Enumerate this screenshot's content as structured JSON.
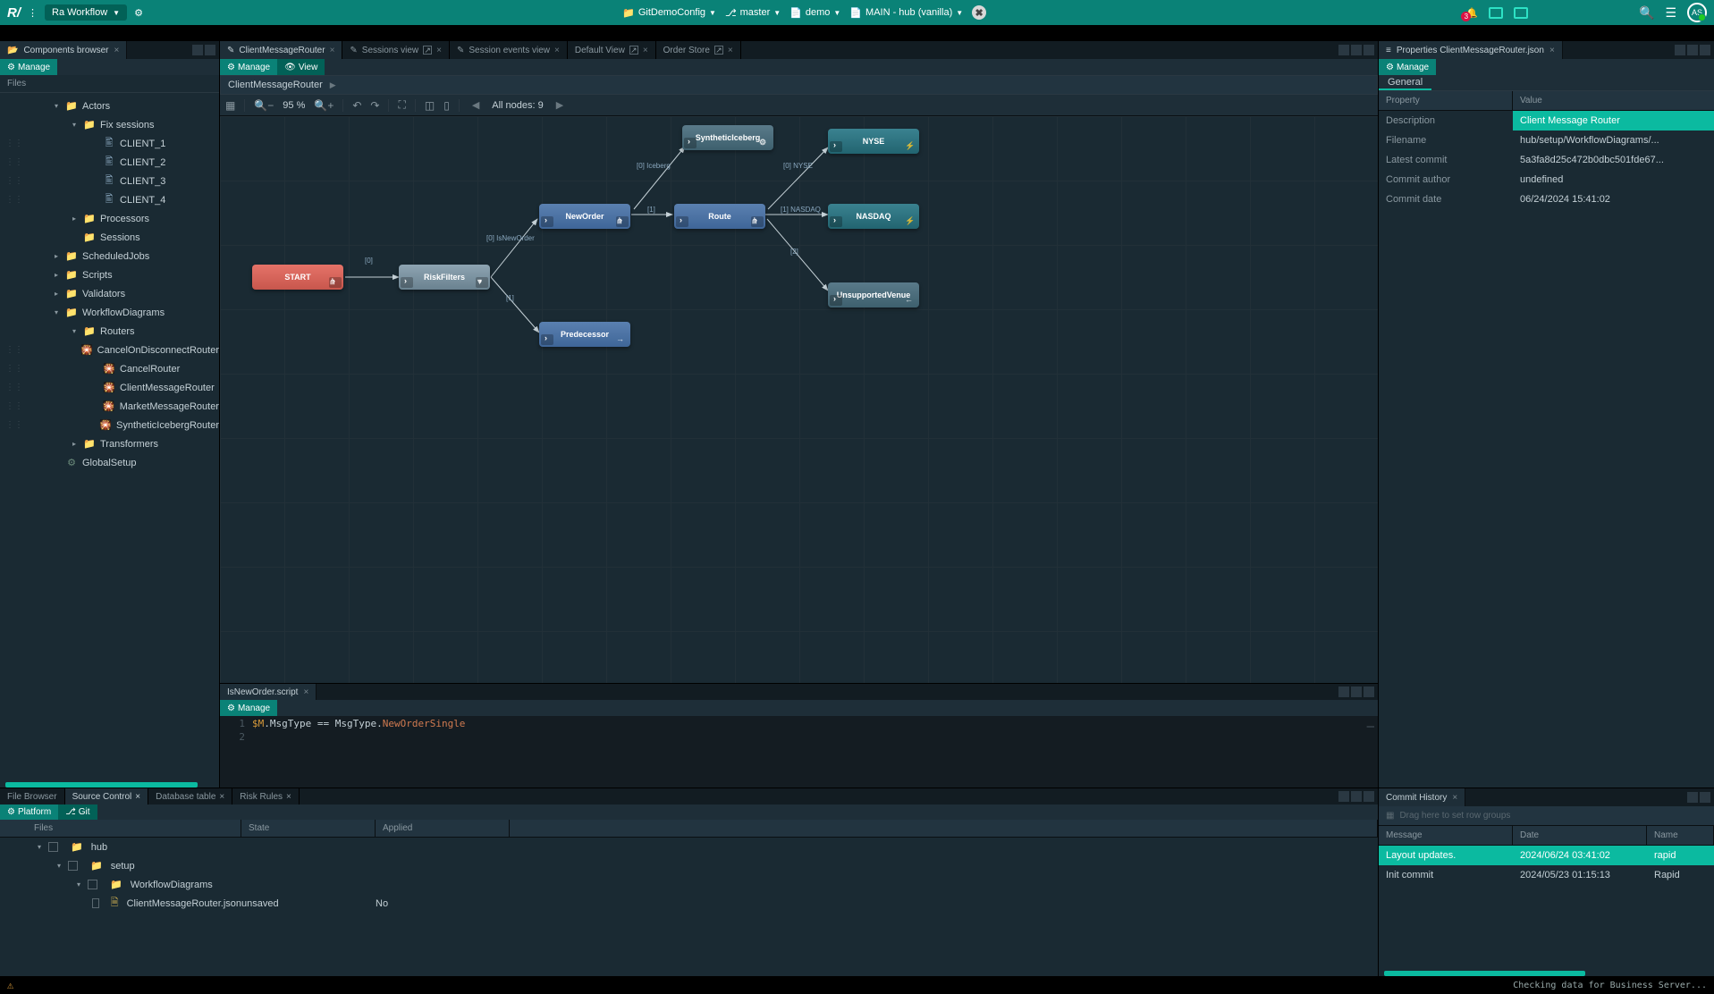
{
  "topbar": {
    "workflow": "Ra Workflow",
    "crumbs": [
      {
        "icon": "📁",
        "label": "GitDemoConfig"
      },
      {
        "icon": "🌿",
        "label": "master"
      },
      {
        "icon": "📄",
        "label": "demo"
      },
      {
        "icon": "📄",
        "label": "MAIN - hub (vanilla)"
      }
    ],
    "notif_count": "3",
    "avatar": "AS"
  },
  "left": {
    "tab": "Components browser",
    "manage": "Manage",
    "files_hdr": "Files",
    "tree": [
      {
        "ind": 30,
        "exp": "▾",
        "fic": "📁",
        "cls": "folder-ic",
        "label": "Actors"
      },
      {
        "ind": 50,
        "exp": "▾",
        "fic": "📁",
        "cls": "folder-purple",
        "label": "Fix sessions"
      },
      {
        "grip": "⋮⋮",
        "ind": 72,
        "fic": "🖺",
        "cls": "file-ic",
        "label": "CLIENT_1"
      },
      {
        "grip": "⋮⋮",
        "ind": 72,
        "fic": "🖺",
        "cls": "file-ic",
        "label": "CLIENT_2"
      },
      {
        "grip": "⋮⋮",
        "ind": 72,
        "fic": "🖺",
        "cls": "file-ic",
        "label": "CLIENT_3"
      },
      {
        "grip": "⋮⋮",
        "ind": 72,
        "fic": "🖺",
        "cls": "file-ic",
        "label": "CLIENT_4"
      },
      {
        "ind": 50,
        "exp": "▸",
        "fic": "📁",
        "cls": "folder-purple",
        "label": "Processors"
      },
      {
        "ind": 50,
        "exp": "",
        "fic": "📁",
        "cls": "folder-purple",
        "label": "Sessions"
      },
      {
        "ind": 30,
        "exp": "▸",
        "fic": "📁",
        "cls": "folder-ic",
        "label": "ScheduledJobs"
      },
      {
        "ind": 30,
        "exp": "▸",
        "fic": "📁",
        "cls": "folder-ic",
        "label": "Scripts"
      },
      {
        "ind": 30,
        "exp": "▸",
        "fic": "📁",
        "cls": "folder-ic",
        "label": "Validators"
      },
      {
        "ind": 30,
        "exp": "▾",
        "fic": "📁",
        "cls": "folder-ic",
        "label": "WorkflowDiagrams"
      },
      {
        "ind": 50,
        "exp": "▾",
        "fic": "📁",
        "cls": "folder-purple",
        "label": "Routers"
      },
      {
        "grip": "⋮⋮",
        "ind": 72,
        "fic": "🎇",
        "cls": "file-ic",
        "label": "CancelOnDisconnectRouter"
      },
      {
        "grip": "⋮⋮",
        "ind": 72,
        "fic": "🎇",
        "cls": "file-ic",
        "label": "CancelRouter"
      },
      {
        "grip": "⋮⋮",
        "ind": 72,
        "fic": "🎇",
        "cls": "file-ic",
        "label": "ClientMessageRouter"
      },
      {
        "grip": "⋮⋮",
        "ind": 72,
        "fic": "🎇",
        "cls": "file-ic",
        "label": "MarketMessageRouter"
      },
      {
        "grip": "⋮⋮",
        "ind": 72,
        "fic": "🎇",
        "cls": "file-ic",
        "label": "SyntheticIcebergRouter"
      },
      {
        "ind": 50,
        "exp": "▸",
        "fic": "📁",
        "cls": "folder-purple",
        "label": "Transformers"
      },
      {
        "ind": 30,
        "exp": "",
        "fic": "⚙",
        "cls": "glob-ic",
        "label": "GlobalSetup"
      }
    ]
  },
  "center_tabs": [
    {
      "active": true,
      "icon": "✎",
      "label": "ClientMessageRouter",
      "close": "×"
    },
    {
      "icon": "✎",
      "label": "Sessions view",
      "ext": "↗",
      "close": "×"
    },
    {
      "icon": "✎",
      "label": "Session events view",
      "close": "×"
    },
    {
      "label": "Default View",
      "ext": "↗",
      "close": "×"
    },
    {
      "label": "Order Store",
      "ext": "↗",
      "close": "×"
    }
  ],
  "wf": {
    "manage": "Manage",
    "view": "View",
    "breadcrumb": "ClientMessageRouter",
    "zoom": "95 %",
    "nodes_label": "All nodes: 9"
  },
  "nodes": {
    "start": "START",
    "risk": "RiskFilters",
    "neworder": "NewOrder",
    "pred": "Predecessor",
    "synth": "SyntheticIceberg",
    "route": "Route",
    "nyse": "NYSE",
    "nasdaq": "NASDAQ",
    "unsup": "UnsupportedVenue"
  },
  "edge_labels": {
    "empty1": "[0]\n ",
    "isneworder": "[0]\nIsNewOrder",
    "one": "[1]",
    "iceberg": "[0]\nIceberg",
    "one2": "[1]",
    "nyse": "[0]\nNYSE",
    "nasdaq": "[1]\nNASDAQ",
    "two": "[2]"
  },
  "script": {
    "tab": "IsNewOrder.script",
    "manage": "Manage",
    "lines": [
      "1",
      "2"
    ],
    "code": "$M.MsgType == MsgType.NewOrderSingle"
  },
  "props": {
    "tab": "Properties ClientMessageRouter.json",
    "manage": "Manage",
    "general": "General",
    "hdr_prop": "Property",
    "hdr_val": "Value",
    "rows": [
      {
        "k": "Description",
        "v": "Client Message Router",
        "hl": true
      },
      {
        "k": "Filename",
        "v": "hub/setup/WorkflowDiagrams/..."
      },
      {
        "k": "Latest commit",
        "v": "5a3fa8d25c472b0dbc501fde67..."
      },
      {
        "k": "Commit author",
        "v": "undefined"
      },
      {
        "k": "Commit date",
        "v": "06/24/2024 15:41:02"
      }
    ]
  },
  "bottom": {
    "tabs": [
      "File Browser",
      "Source Control",
      "Database table",
      "Risk Rules"
    ],
    "sub_platform": "Platform",
    "sub_git": "Git",
    "hdr_files": "Files",
    "hdr_state": "State",
    "hdr_applied": "Applied",
    "rows": [
      {
        "ind": 4,
        "exp": "▾",
        "fic": "📁",
        "cls": "folder-ic",
        "label": "hub"
      },
      {
        "ind": 26,
        "exp": "▾",
        "fic": "📁",
        "cls": "folder-ic",
        "label": "setup"
      },
      {
        "ind": 48,
        "exp": "▾",
        "fic": "📁",
        "cls": "folder-ic",
        "label": "WorkflowDiagrams"
      },
      {
        "ind": 80,
        "fic": "🗎",
        "cls": "json-ic",
        "label": "ClientMessageRouter.json",
        "state": "unsaved",
        "applied": "No"
      }
    ]
  },
  "commit": {
    "tab": "Commit History",
    "drag_hint": "Drag here to set row groups",
    "hdr_msg": "Message",
    "hdr_date": "Date",
    "hdr_name": "Name",
    "rows": [
      {
        "msg": "Layout updates.",
        "date": "2024/06/24 03:41:02",
        "name": "rapid",
        "hl": true
      },
      {
        "msg": "Init commit",
        "date": "2024/05/23 01:15:13",
        "name": "Rapid"
      }
    ]
  },
  "status": "Checking data for Business Server..."
}
